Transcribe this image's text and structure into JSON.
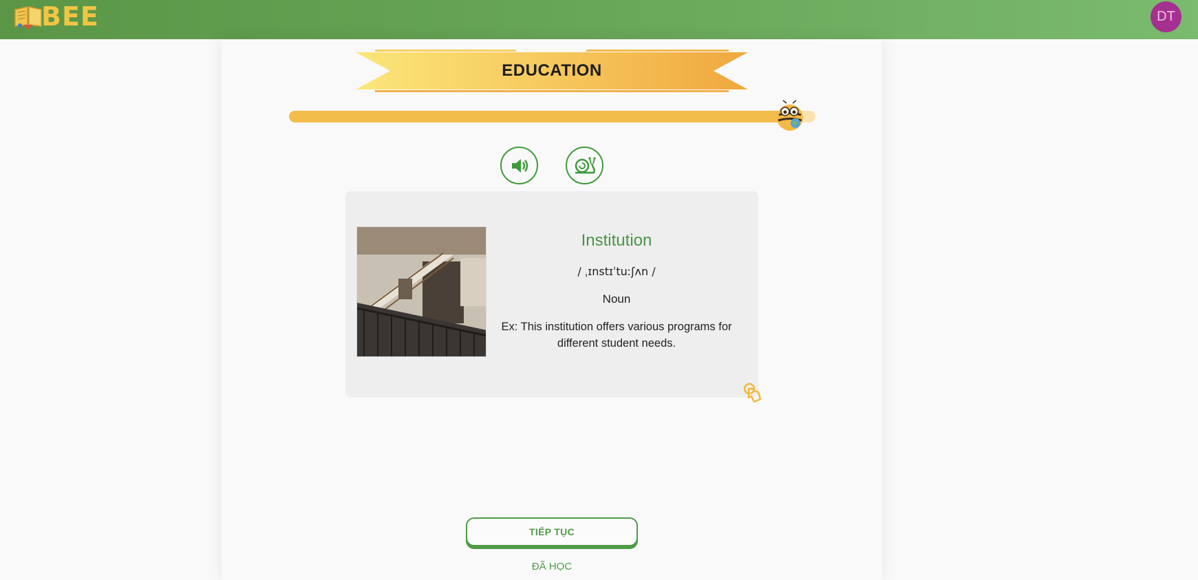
{
  "header": {
    "logo_text": "BEE",
    "avatar_initials": "DT"
  },
  "lesson": {
    "topic_title": "EDUCATION",
    "progress_fraction": 0.94
  },
  "controls": {
    "audio_icon": "speaker-icon",
    "slow_audio_icon": "snail-icon"
  },
  "card": {
    "image_icon": "institution-photo",
    "word": "Institution",
    "phonetic": "/ ˌɪnstɪˈtuːʃʌn /",
    "part_of_speech": "Noun",
    "example": "Ex: This institution offers various programs for different student needs.",
    "flip_icon": "tap-hand-icon"
  },
  "actions": {
    "continue_label": "TIẾP TỤC",
    "learned_label": "ĐÃ HỌC"
  },
  "colors": {
    "header_green": "#5a9646",
    "accent_green": "#4f9b47",
    "progress_orange": "#f3bd4c",
    "avatar_purple": "#a4308f"
  }
}
